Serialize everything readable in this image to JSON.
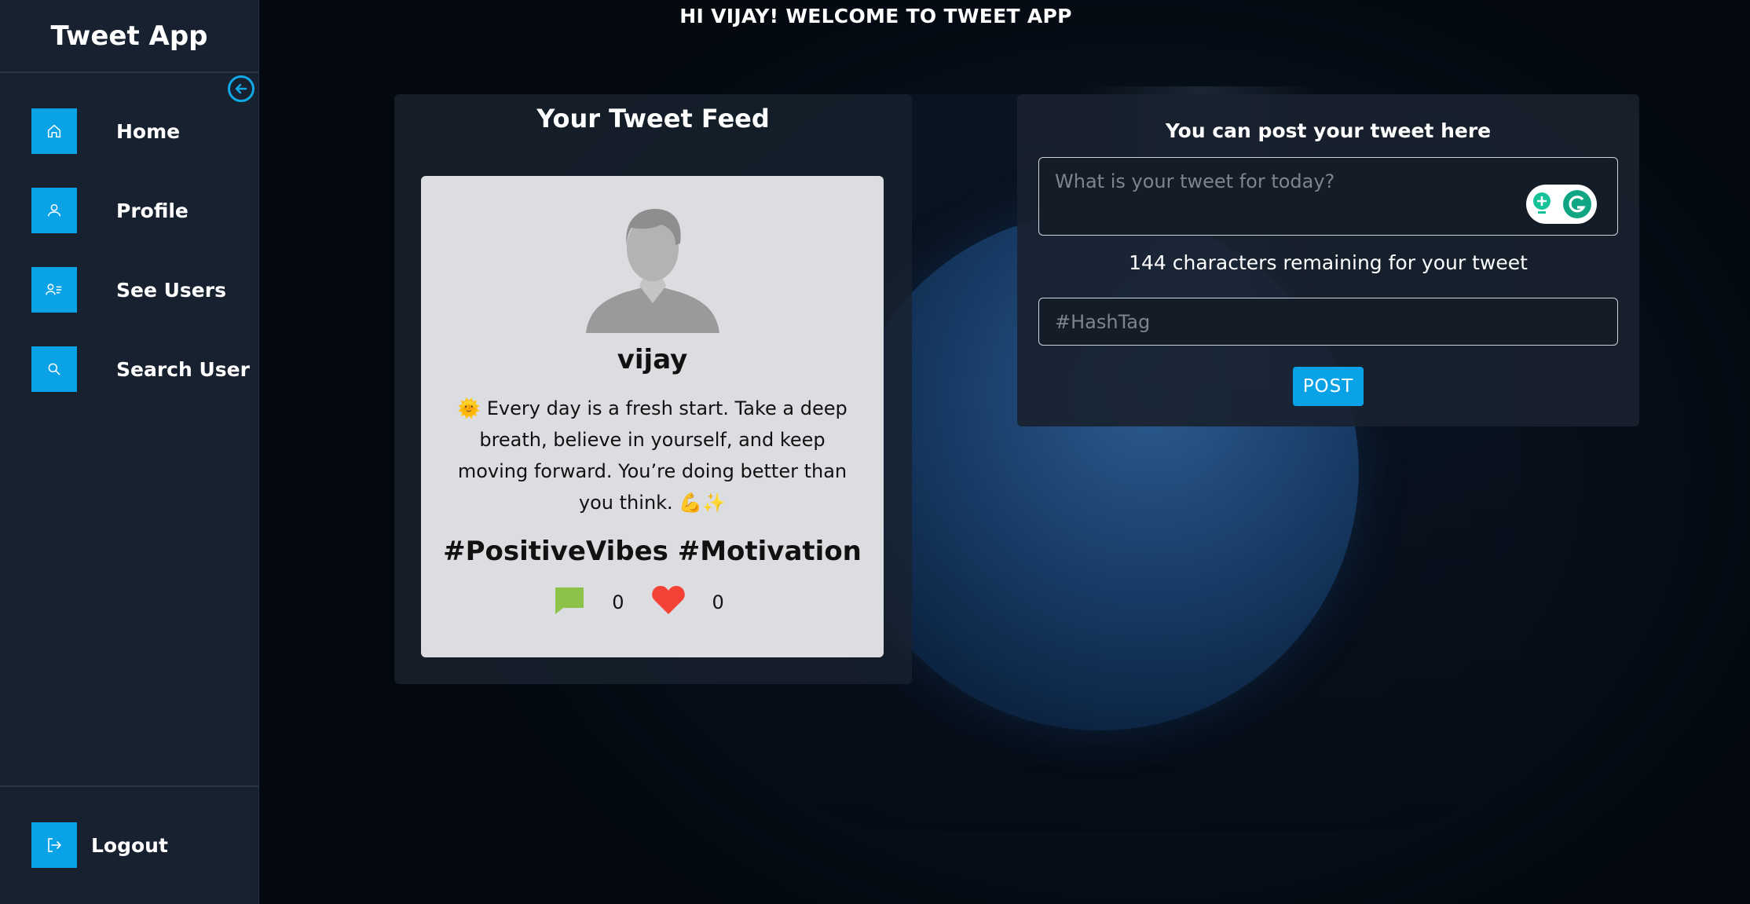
{
  "app": {
    "title": "Tweet App",
    "accent": "#0aa2e6"
  },
  "header": {
    "welcome": "HI VIJAY! WELCOME TO TWEET APP"
  },
  "sidebar": {
    "items": [
      {
        "label": "Home",
        "icon": "home-icon"
      },
      {
        "label": "Profile",
        "icon": "user-icon"
      },
      {
        "label": "See Users",
        "icon": "users-list-icon"
      },
      {
        "label": "Search User",
        "icon": "search-icon"
      }
    ],
    "logout": {
      "label": "Logout",
      "icon": "logout-icon"
    },
    "collapse_icon": "arrow-left-circle-icon"
  },
  "feed": {
    "title": "Your Tweet Feed",
    "tweet": {
      "username": "vijay",
      "text": "🌞 Every day is a fresh start. Take a deep breath, believe in yourself, and keep moving forward. You’re doing better than you think. 💪✨",
      "hashtags": "#PositiveVibes #Motivation",
      "comments": "0",
      "likes": "0"
    }
  },
  "post": {
    "title": "You can post your tweet here",
    "tweet_placeholder": "What is your tweet for today?",
    "remaining": "144 characters remaining for your tweet",
    "hashtag_placeholder": "#HashTag",
    "button": "POST"
  }
}
